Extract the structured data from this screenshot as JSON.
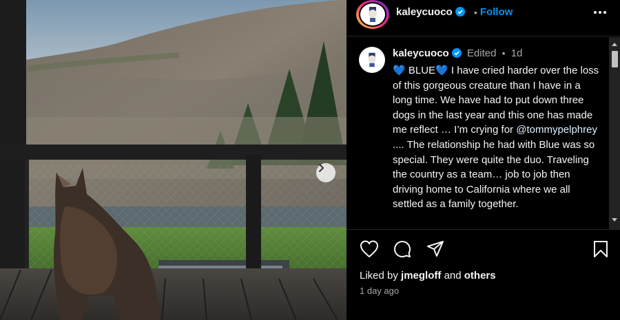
{
  "post": {
    "username": "kaleycuoco",
    "follow_label": "Follow",
    "separator": "•",
    "more_icon": "more-horizontal-icon",
    "carousel_next_icon": "chevron-right-icon"
  },
  "caption": {
    "username": "kaleycuoco",
    "edited_label": "Edited",
    "separator": "•",
    "age": "1d",
    "emoji_left": "💙",
    "title": "BLUE",
    "emoji_right": "💙",
    "body_1": "I have cried harder over the loss of this gorgeous creature than I have in a long time. We have had to put down three dogs in the last year and this one has made me reflect … I’m crying for",
    "mention": "@tommypelphrey",
    "body_2": ".... The relationship he had with Blue was so special. They were quite the duo. Traveling the country as a team… job to job then driving home to California where we all settled as a family together."
  },
  "actions": {
    "like_icon": "heart-icon",
    "comment_icon": "comment-icon",
    "share_icon": "share-icon",
    "save_icon": "bookmark-icon"
  },
  "likes": {
    "prefix": "Liked by",
    "user": "jmegloff",
    "and": "and",
    "others": "others"
  },
  "timestamp": "1 day ago",
  "colors": {
    "background": "#000000",
    "accent": "#0095f6",
    "verified": "#0095f6",
    "muted": "#a8a8a8"
  }
}
